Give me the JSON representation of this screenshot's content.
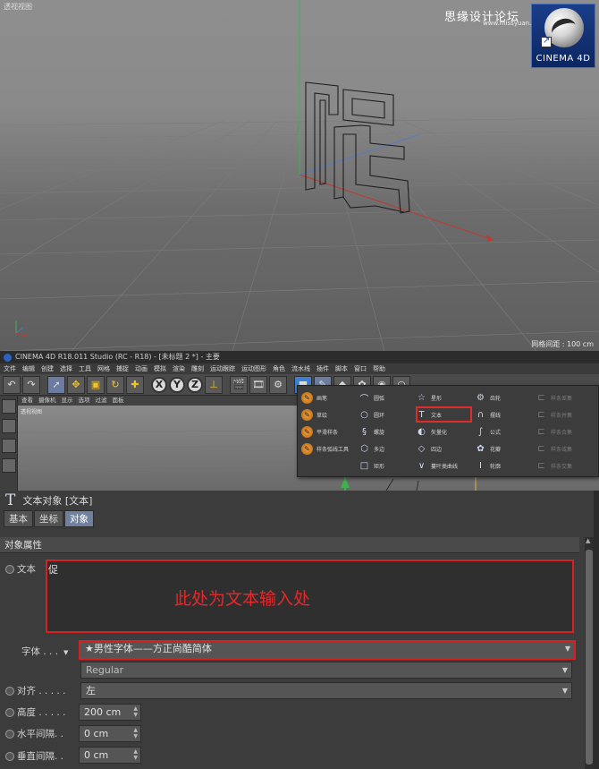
{
  "viewport_top": {
    "label": "透视视图",
    "grid_spacing": "网格间距 : 100 cm",
    "watermark": "思缘设计论坛",
    "watermark_url": "www.missyuan.com",
    "logo_text": "CINEMA 4D"
  },
  "window": {
    "title": "CINEMA 4D R18.011 Studio (RC - R18) - [未标题 2 *] - 主要"
  },
  "menu": [
    "文件",
    "编辑",
    "创建",
    "选择",
    "工具",
    "网格",
    "捕捉",
    "动画",
    "模拟",
    "渲染",
    "雕刻",
    "运动跟踪",
    "运动图形",
    "角色",
    "流水线",
    "插件",
    "脚本",
    "窗口",
    "帮助"
  ],
  "toolbar": {
    "axis_x": "X",
    "axis_y": "Y",
    "axis_z": "Z"
  },
  "viewport_small": {
    "menu": [
      "查看",
      "摄像机",
      "显示",
      "选项",
      "过滤",
      "面板"
    ],
    "label": "透视视图"
  },
  "palette": {
    "col1": [
      "画笔",
      "草绘",
      "平滑样条",
      "样条弧线工具"
    ],
    "col2": [
      "圆弧",
      "圆环",
      "螺旋",
      "多边",
      "矩形"
    ],
    "col3": [
      "星形",
      "文本",
      "矢量化",
      "四边",
      "蔓叶类曲线"
    ],
    "col4": [
      "齿轮",
      "摆线",
      "公式",
      "花瓣",
      "轮廓"
    ],
    "col5": [
      "样条差集",
      "样条并集",
      "样条合集",
      "样条或集",
      "样条交集"
    ]
  },
  "attributes": {
    "header": "文本对象 [文本]",
    "tabs": [
      "基本",
      "坐标",
      "对象"
    ],
    "active_tab": "对象",
    "section": "对象属性",
    "text_label": "文本",
    "text_value": "促",
    "annotation": "此处为文本输入处",
    "font_label": "字体 . . .",
    "font_value": "★男性字体——方正尚酷简体",
    "font_style": "Regular",
    "align_label": "对齐 . . . . .",
    "align_value": "左",
    "height_label": "高度 . . . . .",
    "height_value": "200 cm",
    "hspacing_label": "水平间隔. .",
    "hspacing_value": "0 cm",
    "vspacing_label": "垂直间隔. .",
    "vspacing_value": "0 cm"
  },
  "colors": {
    "highlight": "#d82020",
    "active_tab": "#6f819f"
  }
}
